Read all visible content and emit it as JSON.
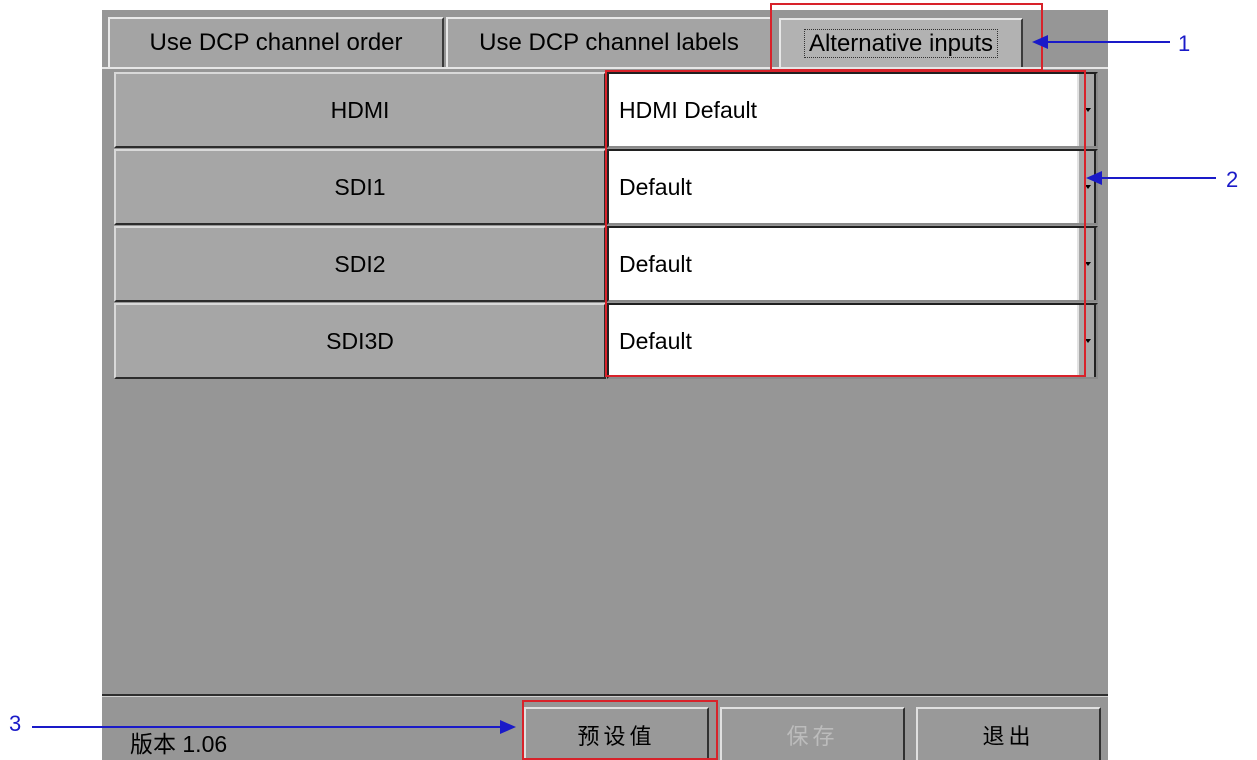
{
  "tabs": [
    {
      "label": "Use DCP channel order"
    },
    {
      "label": "Use DCP channel labels"
    },
    {
      "label": "Alternative inputs"
    }
  ],
  "rows": [
    {
      "label": "HDMI",
      "value": "HDMI Default"
    },
    {
      "label": "SDI1",
      "value": "Default"
    },
    {
      "label": "SDI2",
      "value": "Default"
    },
    {
      "label": "SDI3D",
      "value": "Default"
    }
  ],
  "footer": {
    "version": "版本 1.06",
    "buttons": [
      {
        "label": "预设值",
        "enabled": true
      },
      {
        "label": "保存",
        "enabled": false
      },
      {
        "label": "退出",
        "enabled": true
      }
    ]
  },
  "callouts": [
    "1",
    "2",
    "3"
  ],
  "colors": {
    "highlight": "#d8222a",
    "arrow": "#1a1ac8",
    "panel": "#969696"
  }
}
